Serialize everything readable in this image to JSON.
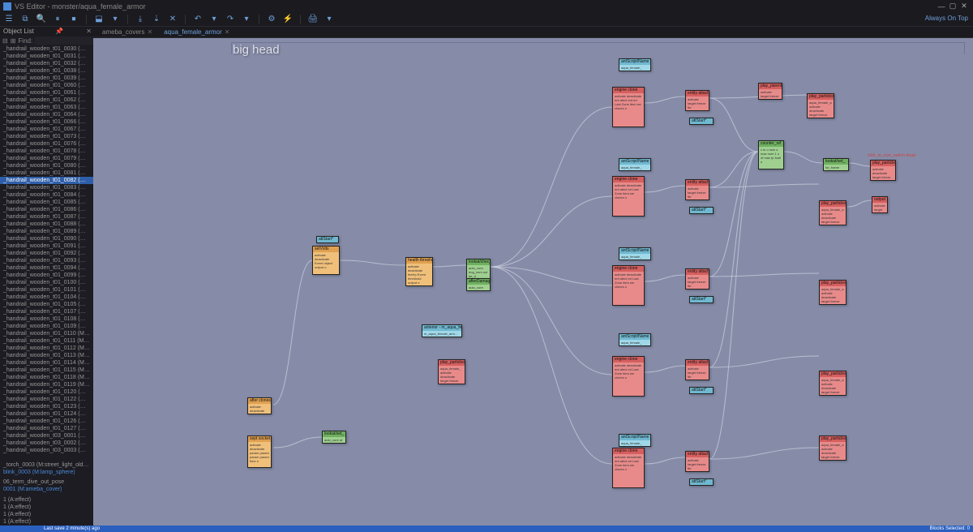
{
  "app": {
    "title": "VS Editor - monster/aqua_female_armor",
    "always_on_top": "Always On Top"
  },
  "window_buttons": {
    "min": "—",
    "max": "▢",
    "close": "✕"
  },
  "toolbar": {
    "icons": [
      "☰",
      "⧉",
      "🔍",
      "⏸",
      "⏹",
      "|",
      "⬓",
      "▾",
      "|",
      "⤓",
      "⇣",
      "✕",
      "|",
      "↶",
      "▾",
      "↷",
      "▾",
      "|",
      "⚙",
      "⚡",
      "|",
      "🖨",
      "▾"
    ]
  },
  "tabs": [
    {
      "label": "ameba_covers",
      "active": false
    },
    {
      "label": "aqua_female_armor",
      "active": true
    }
  ],
  "panel": {
    "title": "Object List",
    "find_label": "Find:"
  },
  "objects": [
    "_handrail_wooden_t01_0030 (M:box_l)",
    "_handrail_wooden_t01_0031 (M:box_l)",
    "_handrail_wooden_t01_0032 (M:box_l)",
    "_handrail_wooden_t01_0038 (M:handr...",
    "_handrail_wooden_t01_0039 (M:wood...",
    "_handrail_wooden_t01_0060 (M:wood...",
    "_handrail_wooden_t01_0061 (M:wood...",
    "_handrail_wooden_t01_0062 (M:wood...",
    "_handrail_wooden_t01_0063 (M:wood...",
    "_handrail_wooden_t01_0064 (M:wood...",
    "_handrail_wooden_t01_0066 (M:wood...",
    "_handrail_wooden_t01_0067 (M:wood...",
    "_handrail_wooden_t01_0073 (M:wood...",
    "_handrail_wooden_t01_0076 (M:wood...",
    "_handrail_wooden_t01_0078 (M:wood...",
    "_handrail_wooden_t01_0079 (M:wood...",
    "_handrail_wooden_t01_0080 (M:wood...",
    "_handrail_wooden_t01_0081 (M:wood...",
    "_handrail_wooden_t01_0082 (M:wood...",
    "_handrail_wooden_t01_0083 (M:wood...",
    "_handrail_wooden_t01_0084 (M:wood...",
    "_handrail_wooden_t01_0085 (M:wood...",
    "_handrail_wooden_t01_0086 (M:wood...",
    "_handrail_wooden_t01_0087 (M:wood...",
    "_handrail_wooden_t01_0088 (M:wood...",
    "_handrail_wooden_t01_0089 (M:wood...",
    "_handrail_wooden_t01_0090 (M:wood...",
    "_handrail_wooden_t01_0091 (M:wood...",
    "_handrail_wooden_t01_0092 (M:wood...",
    "_handrail_wooden_t01_0093 (M:wood...",
    "_handrail_wooden_t01_0094 (M:wood...",
    "_handrail_wooden_t01_0099 (M:wood...",
    "_handrail_wooden_t01_0100 (M:wood...",
    "_handrail_wooden_t01_0101 (M:wood...",
    "_handrail_wooden_t01_0104 (M:wood...",
    "_handrail_wooden_t01_0105 (M:wood...",
    "_handrail_wooden_t01_0107 (M:wood...",
    "_handrail_wooden_t01_0108 (M:wood...",
    "_handrail_wooden_t01_0109 (M:wood...",
    "_handrail_wooden_t01_0110 (M:wood...",
    "_handrail_wooden_t01_0111 (M:wood...",
    "_handrail_wooden_t01_0112 (M:wood...",
    "_handrail_wooden_t01_0113 (M:wood...",
    "_handrail_wooden_t01_0114 (M:wood...",
    "_handrail_wooden_t01_0115 (M:wood...",
    "_handrail_wooden_t01_0118 (M:wood...",
    "_handrail_wooden_t01_0119 (M:wood...",
    "_handrail_wooden_t01_0120 (M:wood...",
    "_handrail_wooden_t01_0122 (M:wood...",
    "_handrail_wooden_t01_0123 (M:wood...",
    "_handrail_wooden_t01_0124 (M:wood...",
    "_handrail_wooden_t01_0126 (M:wood...",
    "_handrail_wooden_t01_0127 (M:handr...",
    "_handrail_wooden_t03_0001 (M:handr...",
    "_handrail_wooden_t03_0002 (M:wood...",
    "_handrail_wooden_t03_0003 (M:handr..."
  ],
  "object_selected_index": 18,
  "categories": [
    "_torch_0003 (M:street_light_old_02)",
    "06_term_dive_out_pose"
  ],
  "links": [
    "blink_0003 (M:lamp_sphere)",
    "0001 (M:ameba_cover)"
  ],
  "effects": [
    "1 (A:effect)",
    "1 (A:effect)",
    "1 (A:effect)",
    "1 (A:effect)",
    "1 (A:effect)"
  ],
  "group": {
    "label": "big head"
  },
  "nodes": {
    "n1": {
      "title": "attStart*",
      "body": ""
    },
    "n2": {
      "title": "setVolts",
      "body": "activate\ndeactivate\nEvent\nobject\noutput o"
    },
    "n3": {
      "title": "health threshold",
      "body": "activate\ndeactivate\ntheHp\nEvent\nthreshold\noutput o"
    },
    "n4": {
      "title": "lookat/chec_",
      "body": "auto_cure\nbug_num\nout\nbe_d"
    },
    "n5": {
      "title": "afterDamage_",
      "body": "auto_cure\n"
    },
    "n6": {
      "title": "anterior - m_aqua_femal...",
      "body": "m_aqua_female_arm..."
    },
    "n7": {
      "title": "play_particles",
      "body": "aqua_female_\nactivate\ndeactivate\ntarget\nfreeze"
    },
    "n8": {
      "title": "after clones",
      "body": "activate\ndeactivate"
    },
    "n9": {
      "title": "sept socket",
      "body": "activate\ndeactivate\nparam\nparam\nparam\nparam\ntime o"
    },
    "n10": {
      "title": "lookat/set_",
      "body": "auto_cure\naf"
    },
    "n11": {
      "title": "engine clone",
      "body": "activate\ndeactivate\nent\nafect\nent\ned Last Zone\nitem\nwe\nclones o"
    },
    "n12": {
      "title": "entity attach",
      "body": "activate\ntarget\nfreeze\nfbr"
    },
    "n13": {
      "title": "attStart*",
      "body": ""
    },
    "n14": {
      "title": "engine clone",
      "body": "activate\ndeactivate\nent\nafect\ned Last Zone\nitem\nwe\nclones o"
    },
    "n15": {
      "title": "entity attach",
      "body": "activate\ntarget\nfreeze\nfbr"
    },
    "n16": {
      "title": "attStart*",
      "body": ""
    },
    "n17": {
      "title": "engine clone",
      "body": "activate\ndeactivate\nent\nafect\ned Last Zone\nitem\nwe\nclones o"
    },
    "n18": {
      "title": "entity attach",
      "body": "activate\ntarget\nfreeze\nfbr"
    },
    "n19": {
      "title": "attStart*",
      "body": ""
    },
    "n20": {
      "title": "engine clone",
      "body": "activate\ndeactivate\nent\nafect\ned Last Zone\nitem\nwe\nclones o"
    },
    "n21": {
      "title": "entity attach",
      "body": "activate\ntarget\nfreeze\nfbr"
    },
    "n22": {
      "title": "attStart*",
      "body": ""
    },
    "n23": {
      "title": "engine clone",
      "body": "activate\ndeactivate\nent\nafect\ned Last Zone\nitem\nwe\nclones o"
    },
    "n24": {
      "title": "entity attach",
      "body": "activate\ntarget\nfreeze\nfbr"
    },
    "n25": {
      "title": "attStart*",
      "body": ""
    },
    "n26": {
      "title": "antScript/Name",
      "body": "aqua_female_"
    },
    "n27": {
      "title": "antScript/Name",
      "body": "aqua_female_"
    },
    "n28": {
      "title": "antScript/Name",
      "body": "aqua_female_"
    },
    "n29": {
      "title": "antScript/Name",
      "body": "aqua_female_"
    },
    "n30": {
      "title": "antScript/Name",
      "body": "aqua_female_"
    },
    "n31": {
      "title": "play_parent",
      "body": "activate\ntarget\nfreeze"
    },
    "n32": {
      "title": "counter_ref",
      "body": "x\nin o\nnew o\nmax num\n1 o of max\ntp\nfoall o"
    },
    "n33": {
      "title": "lookat/set_",
      "body": "for_frame\n"
    },
    "n34": {
      "title": "play_particles",
      "body": "aqua_female_a\nactivate\ndeactivate\ntarget\nfreeze"
    },
    "n35": {
      "title": "play_particles",
      "body": "aqua_female_a\nactivate\ndeactivate\ntarget\nfreeze"
    },
    "n36": {
      "title": "play_particles",
      "body": "aqua_female_a\nactivate\ndeactivate\ntarget\nfreeze"
    },
    "n37": {
      "title": "play_particles",
      "body": "aqua_female_a\nactivate\ndeactivate\ntarget\nfreeze"
    },
    "n38": {
      "title": "play_particles",
      "body": "aqua_female_a\nactivate\ndeactivate\ntarget\nfreeze"
    },
    "n39": {
      "title": "play_particles",
      "body": "activate\ndeactivate\ntarget\nfreeze"
    },
    "n40": {
      "title": "output",
      "body": "activate\ntarget"
    }
  },
  "red_label": "click_to_cure_switch drops",
  "status": {
    "left": "Last save 2 minute(s) ago",
    "right": "Blocks Selected: 0"
  }
}
